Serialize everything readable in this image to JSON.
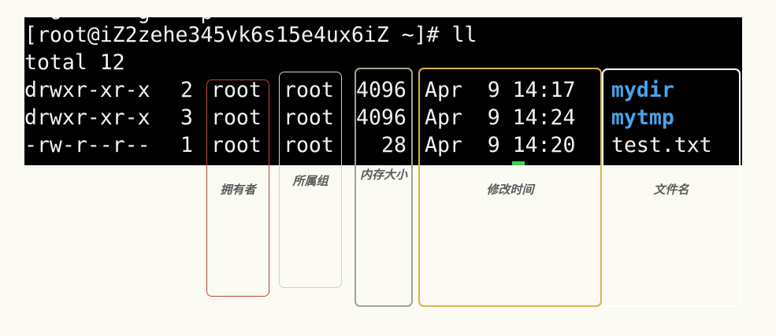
{
  "terminal": {
    "cutoff_text": "  o      g    p",
    "prompt": "[root@iZ2zehe345vk6s15e4ux6iZ ~]# ll",
    "total": "total 12",
    "rows": [
      {
        "perms": "drwxr-xr-x",
        "links": "2",
        "owner": "root",
        "group": "root",
        "size": "4096",
        "date": "Apr  9 14:17",
        "name": "mydir",
        "is_dir": true
      },
      {
        "perms": "drwxr-xr-x",
        "links": "3",
        "owner": "root",
        "group": "root",
        "size": "4096",
        "date": "Apr  9 14:24",
        "name": "mytmp",
        "is_dir": true
      },
      {
        "perms": "-rw-r--r--",
        "links": "1",
        "owner": "root",
        "group": "root",
        "size": "28",
        "date": "Apr  9 14:20",
        "name": "test.txt",
        "is_dir": false
      }
    ],
    "colors": {
      "background": "#000000",
      "text": "#f2f2f2",
      "directory": "#4aa3e8",
      "cursor": "#39d353"
    }
  },
  "annotations": {
    "owner": {
      "label": "拥有者",
      "color": "#c0463c"
    },
    "group": {
      "label": "所属组",
      "color": "#c9ccea"
    },
    "size": {
      "label": "内存大小",
      "color": "#98a88e"
    },
    "mtime": {
      "label": "修改时间",
      "color": "#d8b54a"
    },
    "filename": {
      "label": "文件名",
      "color": "#ffffff"
    }
  }
}
